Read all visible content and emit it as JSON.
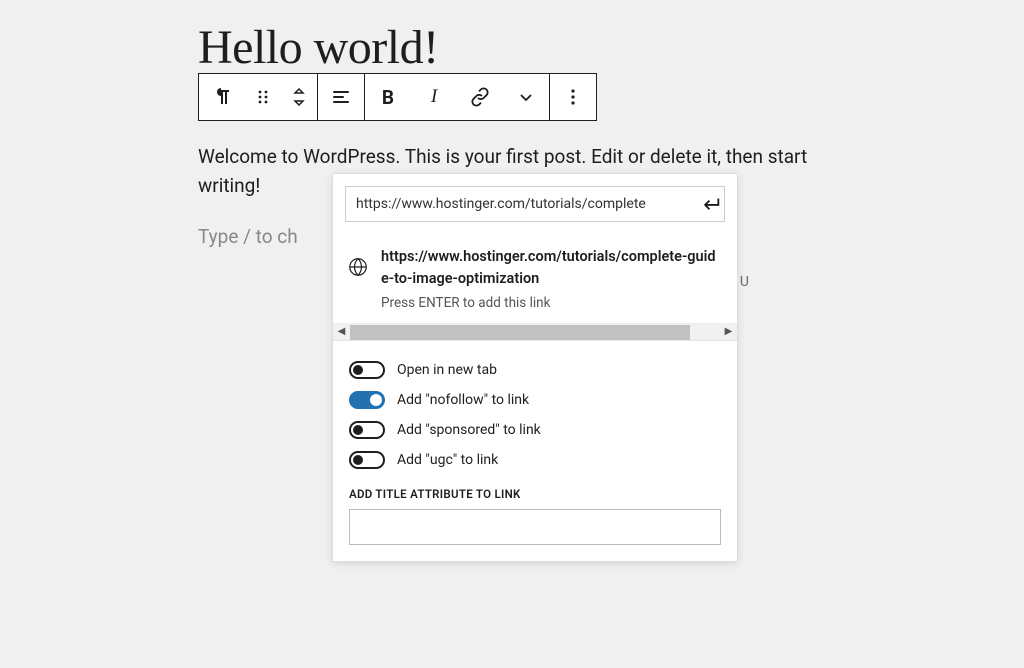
{
  "post": {
    "title": "Hello world!",
    "body": "Welcome to WordPress. This is your first post. Edit or delete it, then start writing!",
    "placeholder": "Type / to ch"
  },
  "toolbar": {
    "block_type": "Paragraph",
    "drag": "Drag",
    "move": "Move",
    "align": "Align",
    "bold": "B",
    "italic": "I",
    "link": "Link",
    "more_rich": "More",
    "options": "Options"
  },
  "link_panel": {
    "url_input": "https://www.hostinger.com/tutorials/complete",
    "suggestion": {
      "url": "https://www.hostinger.com/tutorials/complete-guide-to-image-optimization",
      "hint": "Press ENTER to add this link"
    },
    "badge": "U",
    "toggles": [
      {
        "label": "Open in new tab",
        "on": false
      },
      {
        "label": "Add \"nofollow\" to link",
        "on": true
      },
      {
        "label": "Add \"sponsored\" to link",
        "on": false
      },
      {
        "label": "Add \"ugc\" to link",
        "on": false
      }
    ],
    "title_field_label": "ADD TITLE ATTRIBUTE TO LINK",
    "title_field_value": ""
  }
}
